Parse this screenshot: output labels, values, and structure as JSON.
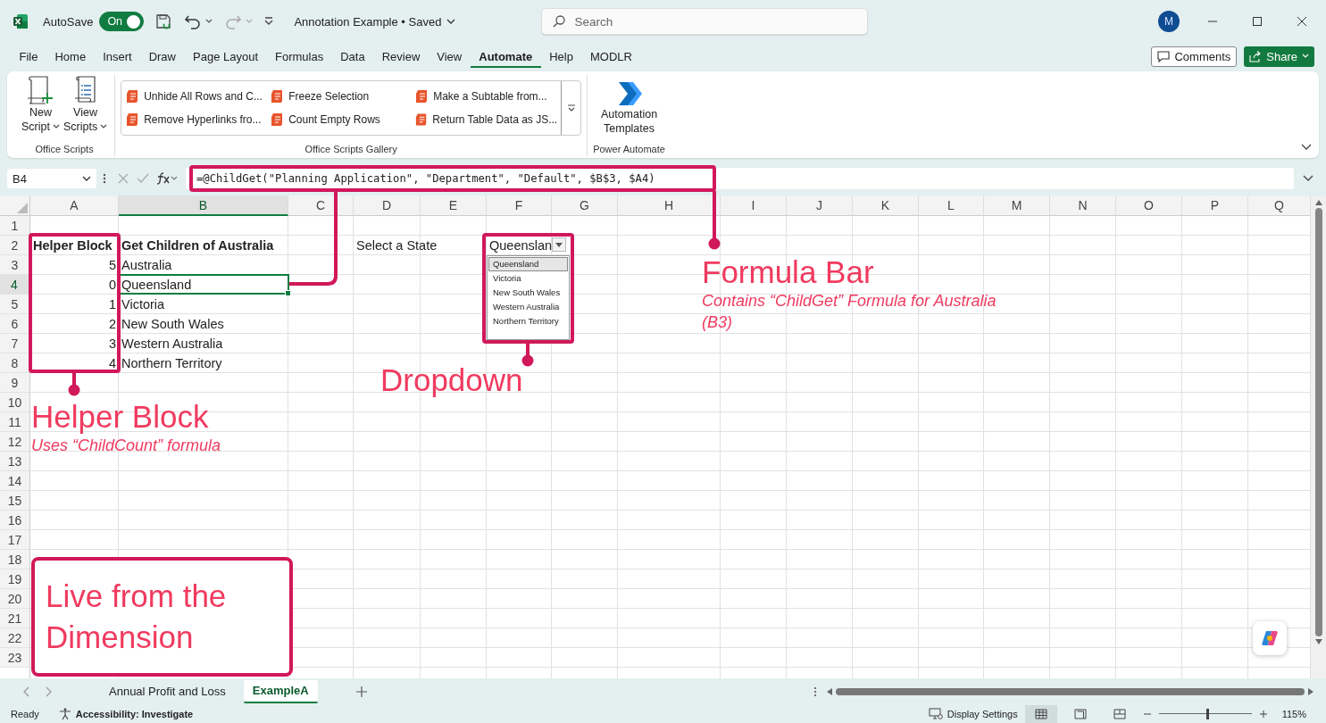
{
  "app": {
    "autosave_label": "AutoSave",
    "autosave": {
      "label": "On",
      "on": true
    },
    "title": "Annotation Example • Saved",
    "search_placeholder": "Search",
    "avatar": "M"
  },
  "menu_tabs": [
    {
      "label": "File",
      "selected": false
    },
    {
      "label": "Home",
      "selected": false
    },
    {
      "label": "Insert",
      "selected": false
    },
    {
      "label": "Draw",
      "selected": false
    },
    {
      "label": "Page Layout",
      "selected": false
    },
    {
      "label": "Formulas",
      "selected": false
    },
    {
      "label": "Data",
      "selected": false
    },
    {
      "label": "Review",
      "selected": false
    },
    {
      "label": "View",
      "selected": false
    },
    {
      "label": "Automate",
      "selected": true
    },
    {
      "label": "Help",
      "selected": false
    },
    {
      "label": "MODLR",
      "selected": false
    }
  ],
  "actions": {
    "comments": "Comments",
    "share": "Share"
  },
  "ribbon": {
    "groups": [
      {
        "kind": "scripts",
        "label": "Office Scripts",
        "buttons": [
          {
            "kind": "new",
            "lines": [
              "New",
              "Script"
            ]
          },
          {
            "kind": "view",
            "lines": [
              "View",
              "Scripts"
            ]
          }
        ]
      },
      {
        "kind": "gallery",
        "label": "Office Scripts Gallery",
        "items": [
          "Unhide All Rows and C...",
          "Freeze Selection",
          "Make a Subtable from...",
          "Remove Hyperlinks fro...",
          "Count Empty Rows",
          "Return Table Data as JS..."
        ]
      },
      {
        "kind": "automate",
        "label": "Power Automate",
        "buttons": [
          {
            "kind": "flow",
            "lines": [
              "Automation",
              "Templates"
            ]
          }
        ]
      }
    ]
  },
  "formula_bar": {
    "name_box": "B4",
    "formula": "=@ChildGet(\"Planning Application\", \"Department\", \"Default\", $B$3, $A4)"
  },
  "sheet": {
    "columns": [
      {
        "label": "A",
        "selected": false
      },
      {
        "label": "B",
        "selected": true
      },
      {
        "label": "C",
        "selected": false
      },
      {
        "label": "D",
        "selected": false
      },
      {
        "label": "E",
        "selected": false
      },
      {
        "label": "F",
        "selected": false
      },
      {
        "label": "G",
        "selected": false
      },
      {
        "label": "H",
        "selected": false
      },
      {
        "label": "I",
        "selected": false
      },
      {
        "label": "J",
        "selected": false
      },
      {
        "label": "K",
        "selected": false
      },
      {
        "label": "L",
        "selected": false
      },
      {
        "label": "M",
        "selected": false
      },
      {
        "label": "N",
        "selected": false
      },
      {
        "label": "O",
        "selected": false
      },
      {
        "label": "P",
        "selected": false
      },
      {
        "label": "Q",
        "selected": false
      }
    ],
    "rows": [
      {
        "label": "1",
        "selected": false
      },
      {
        "label": "2",
        "selected": false,
        "cells": [
          {
            "text": "Helper Block",
            "kind": "header",
            "selected": false
          },
          {
            "text": "Get Children of Australia",
            "kind": "header",
            "selected": false
          }
        ]
      },
      {
        "label": "3",
        "selected": false,
        "cells": [
          {
            "text": "5",
            "kind": "number",
            "selected": false
          },
          {
            "text": "Australia",
            "kind": "text",
            "selected": false
          }
        ]
      },
      {
        "label": "4",
        "selected": true,
        "cells": [
          {
            "text": "0",
            "kind": "number",
            "selected": false
          },
          {
            "text": "Queensland",
            "kind": "text",
            "selected": true
          }
        ]
      },
      {
        "label": "5",
        "selected": false,
        "cells": [
          {
            "text": "1",
            "kind": "number",
            "selected": false
          },
          {
            "text": "Victoria",
            "kind": "text",
            "selected": false
          }
        ]
      },
      {
        "label": "6",
        "selected": false,
        "cells": [
          {
            "text": "2",
            "kind": "number",
            "selected": false
          },
          {
            "text": "New South Wales",
            "kind": "text",
            "selected": false
          }
        ]
      },
      {
        "label": "7",
        "selected": false,
        "cells": [
          {
            "text": "3",
            "kind": "number",
            "selected": false
          },
          {
            "text": "Western Australia",
            "kind": "text",
            "selected": false
          }
        ]
      },
      {
        "label": "8",
        "selected": false,
        "cells": [
          {
            "text": "4",
            "kind": "number",
            "selected": false
          },
          {
            "text": "Northern Territory",
            "kind": "text",
            "selected": false
          }
        ]
      },
      {
        "label": "9",
        "selected": false
      },
      {
        "label": "10",
        "selected": false
      },
      {
        "label": "11",
        "selected": false
      },
      {
        "label": "12",
        "selected": false
      },
      {
        "label": "13",
        "selected": false
      },
      {
        "label": "14",
        "selected": false
      },
      {
        "label": "15",
        "selected": false
      },
      {
        "label": "16",
        "selected": false
      },
      {
        "label": "17",
        "selected": false
      },
      {
        "label": "18",
        "selected": false
      },
      {
        "label": "19",
        "selected": false
      },
      {
        "label": "20",
        "selected": false
      },
      {
        "label": "21",
        "selected": false
      },
      {
        "label": "22",
        "selected": false
      },
      {
        "label": "23",
        "selected": false
      }
    ],
    "selector": {
      "label": "Select a State",
      "value": "Queenslan",
      "options": [
        {
          "label": "Queensland",
          "selected": true
        },
        {
          "label": "Victoria",
          "selected": false
        },
        {
          "label": "New South Wales",
          "selected": false
        },
        {
          "label": "Western Australia",
          "selected": false
        },
        {
          "label": "Northern Territory",
          "selected": false
        }
      ]
    }
  },
  "annotations": [
    {
      "kind": "formula",
      "title": "Formula Bar",
      "note": "Contains “ChildGet” Formula for Australia (B3)"
    },
    {
      "kind": "dropdown",
      "title": "Dropdown"
    },
    {
      "kind": "helper",
      "title": "Helper Block",
      "note": "Uses “ChildCount” formula"
    },
    {
      "kind": "live",
      "title": "Live from the Dimension"
    }
  ],
  "sheet_tabs": [
    {
      "label": "Annual Profit and Loss",
      "selected": false
    },
    {
      "label": "ExampleA",
      "selected": true
    }
  ],
  "status_bar": {
    "ready": "Ready",
    "accessibility": "Accessibility: Investigate",
    "display": "Display Settings",
    "views": [
      {
        "kind": "normal",
        "selected": true
      },
      {
        "kind": "page_layout",
        "selected": false
      },
      {
        "kind": "page_break",
        "selected": false
      }
    ],
    "zoom": {
      "level": 0.52,
      "label": "115%"
    }
  }
}
